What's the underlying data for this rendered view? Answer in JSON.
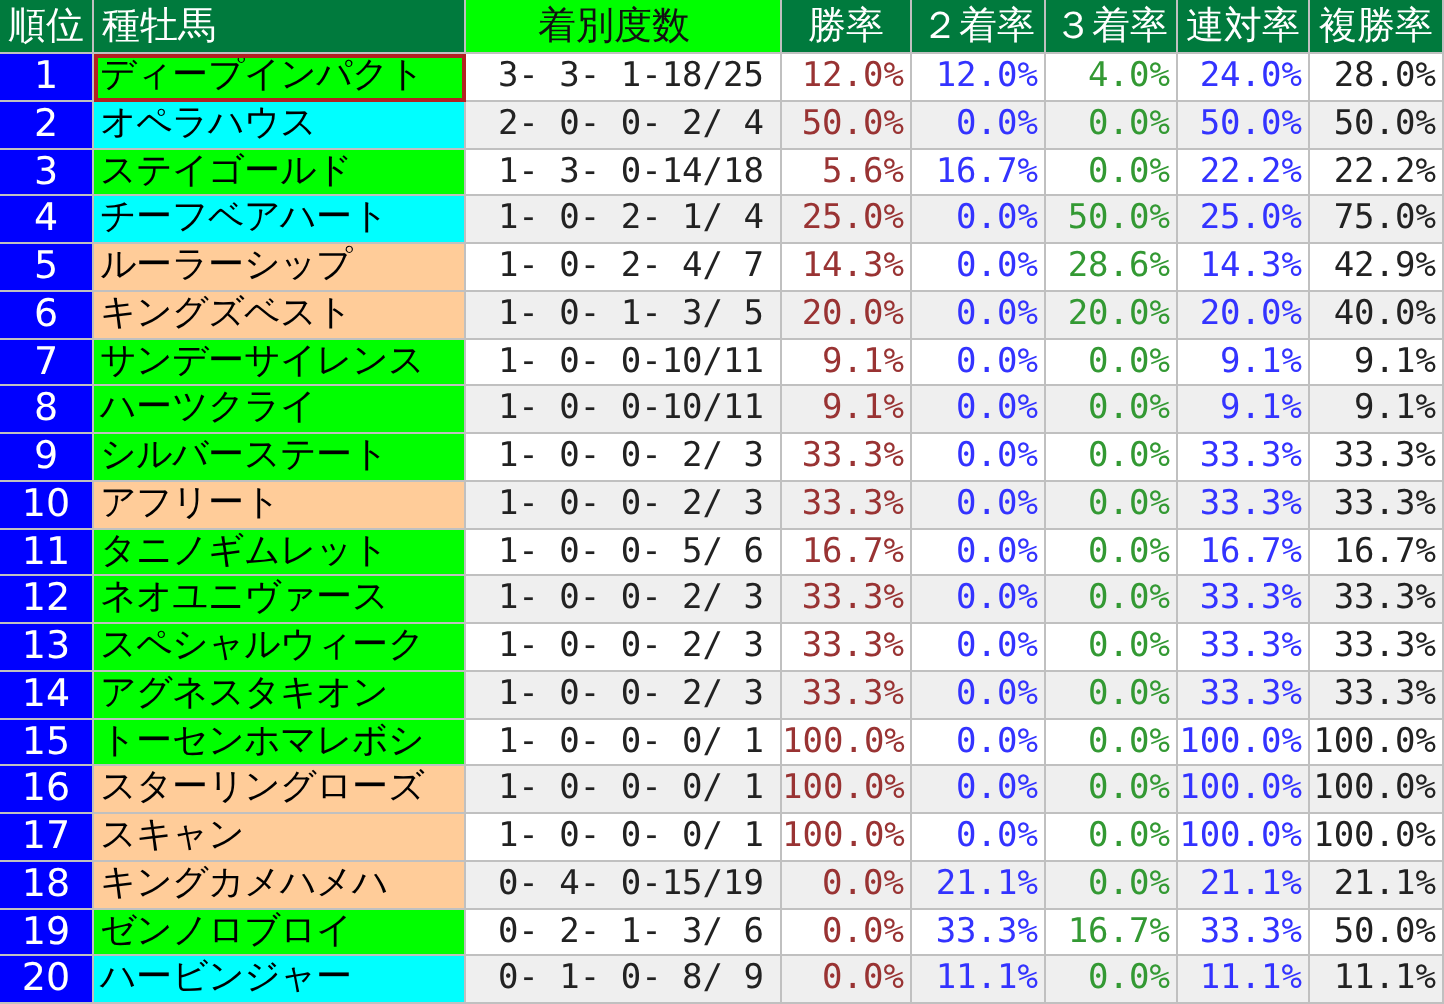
{
  "table": {
    "columns": [
      {
        "label": "順位",
        "color": "#007a3d"
      },
      {
        "label": "種牡馬",
        "color": "#007a3d"
      },
      {
        "label": "着別度数",
        "color": "#00ff00"
      },
      {
        "label": "勝率",
        "color": "#007a3d"
      },
      {
        "label": "２着率",
        "color": "#007a3d"
      },
      {
        "label": "３着率",
        "color": "#007a3d"
      },
      {
        "label": "連対率",
        "color": "#007a3d"
      },
      {
        "label": "複勝率",
        "color": "#007a3d"
      }
    ],
    "rows": [
      {
        "color": "#00ff00",
        "selected": true,
        "cells": [
          "1",
          "ディープインパクト",
          "3- 3- 1-18/25",
          "12.0%",
          "12.0%",
          "4.0%",
          "24.0%",
          "28.0%"
        ]
      },
      {
        "color": "#00ffff",
        "selected": false,
        "cells": [
          "2",
          "オペラハウス",
          "2- 0- 0- 2/ 4",
          "50.0%",
          "0.0%",
          "0.0%",
          "50.0%",
          "50.0%"
        ]
      },
      {
        "color": "#00ff00",
        "selected": false,
        "cells": [
          "3",
          "ステイゴールド",
          "1- 3- 0-14/18",
          "5.6%",
          "16.7%",
          "0.0%",
          "22.2%",
          "22.2%"
        ]
      },
      {
        "color": "#00ffff",
        "selected": false,
        "cells": [
          "4",
          "チーフベアハート",
          "1- 0- 2- 1/ 4",
          "25.0%",
          "0.0%",
          "50.0%",
          "25.0%",
          "75.0%"
        ]
      },
      {
        "color": "#ffcc99",
        "selected": false,
        "cells": [
          "5",
          "ルーラーシップ",
          "1- 0- 2- 4/ 7",
          "14.3%",
          "0.0%",
          "28.6%",
          "14.3%",
          "42.9%"
        ]
      },
      {
        "color": "#ffcc99",
        "selected": false,
        "cells": [
          "6",
          "キングズベスト",
          "1- 0- 1- 3/ 5",
          "20.0%",
          "0.0%",
          "20.0%",
          "20.0%",
          "40.0%"
        ]
      },
      {
        "color": "#00ff00",
        "selected": false,
        "cells": [
          "7",
          "サンデーサイレンス",
          "1- 0- 0-10/11",
          "9.1%",
          "0.0%",
          "0.0%",
          "9.1%",
          "9.1%"
        ]
      },
      {
        "color": "#00ff00",
        "selected": false,
        "cells": [
          "8",
          "ハーツクライ",
          "1- 0- 0-10/11",
          "9.1%",
          "0.0%",
          "0.0%",
          "9.1%",
          "9.1%"
        ]
      },
      {
        "color": "#00ff00",
        "selected": false,
        "cells": [
          "9",
          "シルバーステート",
          "1- 0- 0- 2/ 3",
          "33.3%",
          "0.0%",
          "0.0%",
          "33.3%",
          "33.3%"
        ]
      },
      {
        "color": "#ffcc99",
        "selected": false,
        "cells": [
          "10",
          "アフリート",
          "1- 0- 0- 2/ 3",
          "33.3%",
          "0.0%",
          "0.0%",
          "33.3%",
          "33.3%"
        ]
      },
      {
        "color": "#00ff00",
        "selected": false,
        "cells": [
          "11",
          "タニノギムレット",
          "1- 0- 0- 5/ 6",
          "16.7%",
          "0.0%",
          "0.0%",
          "16.7%",
          "16.7%"
        ]
      },
      {
        "color": "#00ff00",
        "selected": false,
        "cells": [
          "12",
          "ネオユニヴァース",
          "1- 0- 0- 2/ 3",
          "33.3%",
          "0.0%",
          "0.0%",
          "33.3%",
          "33.3%"
        ]
      },
      {
        "color": "#00ff00",
        "selected": false,
        "cells": [
          "13",
          "スペシャルウィーク",
          "1- 0- 0- 2/ 3",
          "33.3%",
          "0.0%",
          "0.0%",
          "33.3%",
          "33.3%"
        ]
      },
      {
        "color": "#00ff00",
        "selected": false,
        "cells": [
          "14",
          "アグネスタキオン",
          "1- 0- 0- 2/ 3",
          "33.3%",
          "0.0%",
          "0.0%",
          "33.3%",
          "33.3%"
        ]
      },
      {
        "color": "#00ff00",
        "selected": false,
        "cells": [
          "15",
          "トーセンホマレボシ",
          "1- 0- 0- 0/ 1",
          "100.0%",
          "0.0%",
          "0.0%",
          "100.0%",
          "100.0%"
        ]
      },
      {
        "color": "#ffcc99",
        "selected": false,
        "cells": [
          "16",
          "スターリングローズ",
          "1- 0- 0- 0/ 1",
          "100.0%",
          "0.0%",
          "0.0%",
          "100.0%",
          "100.0%"
        ]
      },
      {
        "color": "#ffcc99",
        "selected": false,
        "cells": [
          "17",
          "スキャン",
          "1- 0- 0- 0/ 1",
          "100.0%",
          "0.0%",
          "0.0%",
          "100.0%",
          "100.0%"
        ]
      },
      {
        "color": "#ffcc99",
        "selected": false,
        "cells": [
          "18",
          "キングカメハメハ",
          "0- 4- 0-15/19",
          "0.0%",
          "21.1%",
          "0.0%",
          "21.1%",
          "21.1%"
        ]
      },
      {
        "color": "#00ff00",
        "selected": false,
        "cells": [
          "19",
          "ゼンノロブロイ",
          "0- 2- 1- 3/ 6",
          "0.0%",
          "33.3%",
          "16.7%",
          "33.3%",
          "50.0%"
        ]
      },
      {
        "color": "#00ffff",
        "selected": false,
        "cells": [
          "20",
          "ハービンジャー",
          "0- 1- 0- 8/ 9",
          "0.0%",
          "11.1%",
          "0.0%",
          "11.1%",
          "11.1%"
        ]
      }
    ]
  }
}
